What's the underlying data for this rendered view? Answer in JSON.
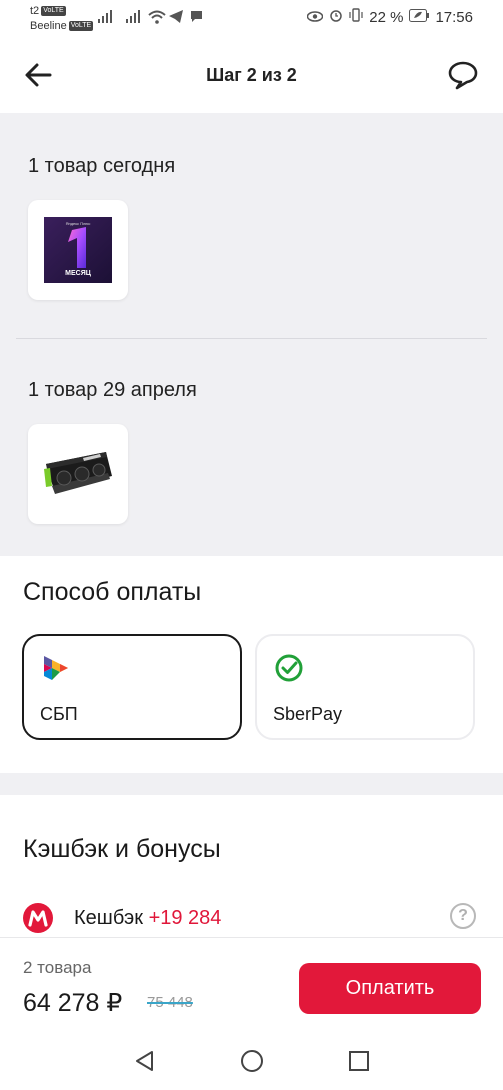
{
  "status_bar": {
    "carrier1": "t2",
    "carrier2": "Beeline",
    "volte": "VoLTE",
    "battery": "22 %",
    "time": "17:56"
  },
  "header": {
    "title": "Шаг 2 из 2"
  },
  "groups": [
    {
      "title": "1 товар сегодня",
      "thumb_caption_top": "Яндекс Плюс",
      "thumb_caption": "МЕСЯЦ"
    },
    {
      "title": "1 товар 29 апреля"
    }
  ],
  "payment": {
    "title": "Способ оплаты",
    "options": [
      {
        "label": "СБП",
        "selected": true
      },
      {
        "label": "SberPay",
        "selected": false
      }
    ]
  },
  "cashback": {
    "title": "Кэшбэк и бонусы",
    "label": "Кешбэк",
    "value": "+19 284",
    "help": "?"
  },
  "summary": {
    "count": "2 товара",
    "price": "64 278 ₽",
    "old_price": "75 448",
    "pay_button": "Оплатить"
  },
  "colors": {
    "accent": "#e2183a",
    "background_gray": "#f0f0f3"
  }
}
